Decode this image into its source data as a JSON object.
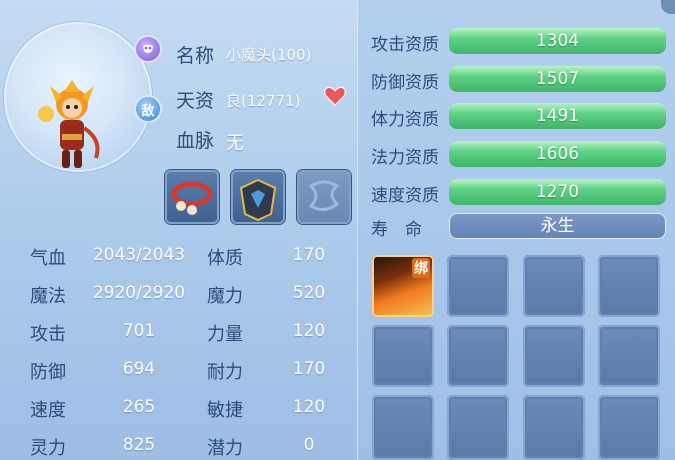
{
  "pet": {
    "name_label": "名称",
    "name_value": "小魔头(100)",
    "aptitude_label": "天资",
    "aptitude_value": "良(12771)",
    "bloodline_label": "血脉",
    "bloodline_value": "无",
    "hostile_badge": "敌"
  },
  "stats": [
    {
      "label": "气血",
      "value": "2043/2043"
    },
    {
      "label": "魔法",
      "value": "2920/2920"
    },
    {
      "label": "攻击",
      "value": "701"
    },
    {
      "label": "防御",
      "value": "694"
    },
    {
      "label": "速度",
      "value": "265"
    },
    {
      "label": "灵力",
      "value": "825"
    }
  ],
  "attributes": [
    {
      "label": "体质",
      "value": "170"
    },
    {
      "label": "魔力",
      "value": "520"
    },
    {
      "label": "力量",
      "value": "120"
    },
    {
      "label": "耐力",
      "value": "170"
    },
    {
      "label": "敏捷",
      "value": "120"
    },
    {
      "label": "潜力",
      "value": "0"
    }
  ],
  "aptitudes": [
    {
      "label": "攻击资质",
      "value": "1304",
      "fill": 1.0
    },
    {
      "label": "防御资质",
      "value": "1507",
      "fill": 1.0
    },
    {
      "label": "体力资质",
      "value": "1491",
      "fill": 1.0
    },
    {
      "label": "法力资质",
      "value": "1606",
      "fill": 1.0
    },
    {
      "label": "速度资质",
      "value": "1270",
      "fill": 1.0
    }
  ],
  "lifespan": {
    "label": "寿　命",
    "value": "永生"
  },
  "skills": {
    "first_badge": "绑"
  },
  "colors": {
    "label_text": "#2d4c7d",
    "bar_green": "#3fb46a",
    "heart": "#e85a5a"
  }
}
